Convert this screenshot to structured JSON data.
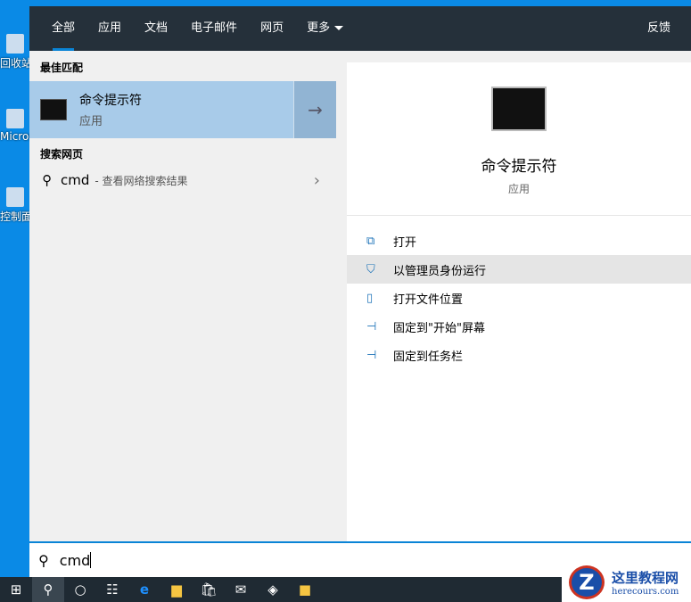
{
  "desktop": {
    "icons": [
      {
        "label": "回收站"
      },
      {
        "label": "Microsoft Edge"
      },
      {
        "label": "控制面板"
      }
    ]
  },
  "header": {
    "tabs": [
      "全部",
      "应用",
      "文档",
      "电子邮件",
      "网页",
      "更多"
    ],
    "feedback": "反馈"
  },
  "left": {
    "best_match_heading": "最佳匹配",
    "best_match": {
      "title": "命令提示符",
      "type": "应用"
    },
    "web_heading": "搜索网页",
    "web": {
      "query": "cmd",
      "suffix": "- 查看网络搜索结果"
    }
  },
  "right": {
    "title": "命令提示符",
    "type": "应用",
    "actions": [
      "打开",
      "以管理员身份运行",
      "打开文件位置",
      "固定到\"开始\"屏幕",
      "固定到任务栏"
    ]
  },
  "search": {
    "value": "cmd"
  },
  "watermark": {
    "name": "这里教程网",
    "url": "herecours.com"
  }
}
